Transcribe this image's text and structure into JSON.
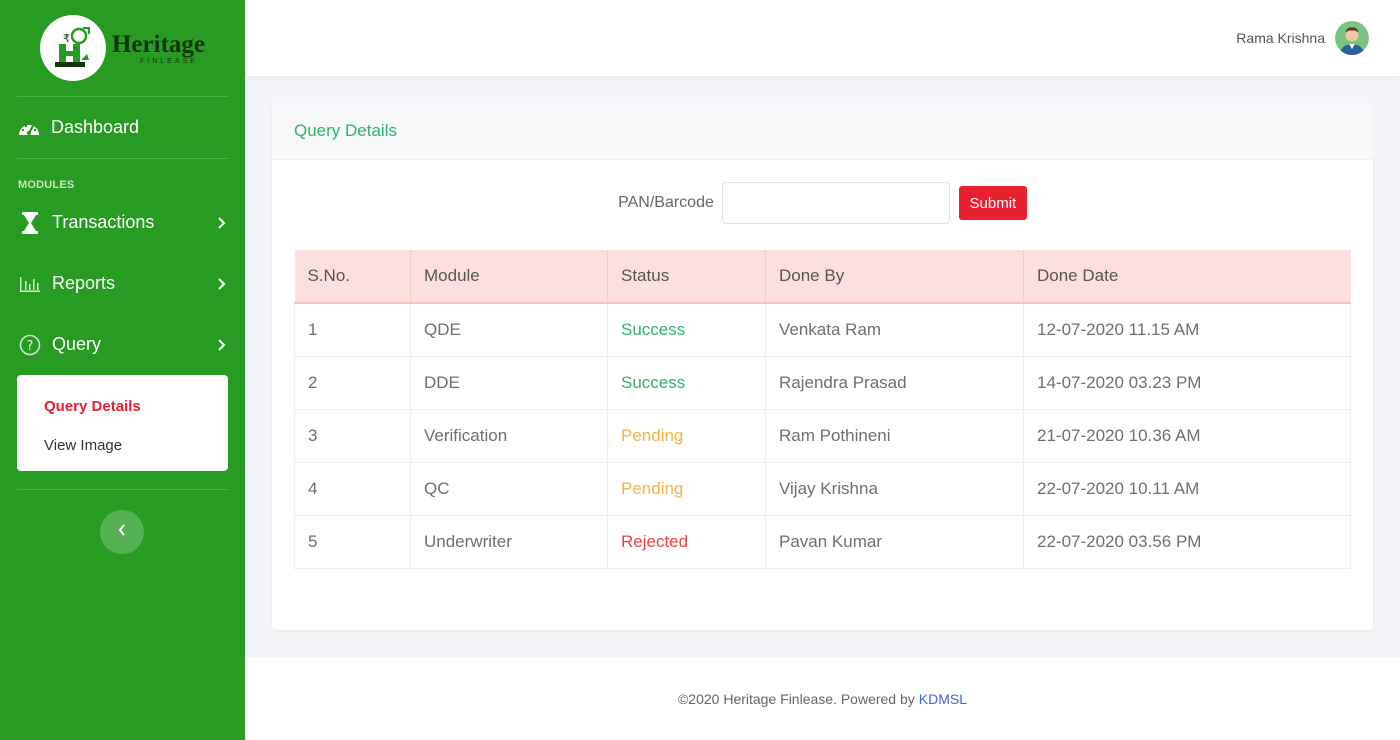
{
  "brand": {
    "name": "Heritage",
    "sub": "FINLEASE"
  },
  "sidebar": {
    "dashboard_label": "Dashboard",
    "modules_label": "MODULES",
    "items": [
      {
        "label": "Transactions",
        "icon": "hourglass-icon"
      },
      {
        "label": "Reports",
        "icon": "bar-chart-icon"
      },
      {
        "label": "Query",
        "icon": "question-circle-icon"
      }
    ],
    "submenu": [
      {
        "label": "Query Details",
        "active": true
      },
      {
        "label": "View Image",
        "active": false
      }
    ]
  },
  "header": {
    "user_name": "Rama Krishna"
  },
  "card": {
    "title": "Query Details",
    "search_label": "PAN/Barcode",
    "search_value": "",
    "submit_label": "Submit"
  },
  "table": {
    "columns": [
      "S.No.",
      "Module",
      "Status",
      "Done By",
      "Done Date"
    ],
    "rows": [
      {
        "sno": "1",
        "module": "QDE",
        "status": "Success",
        "done_by": "Venkata Ram",
        "done_date": "12-07-2020 11.15 AM"
      },
      {
        "sno": "2",
        "module": "DDE",
        "status": "Success",
        "done_by": "Rajendra Prasad",
        "done_date": "14-07-2020 03.23 PM"
      },
      {
        "sno": "3",
        "module": "Verification",
        "status": "Pending",
        "done_by": "Ram Pothineni",
        "done_date": "21-07-2020 10.36 AM"
      },
      {
        "sno": "4",
        "module": "QC",
        "status": "Pending",
        "done_by": "Vijay Krishna",
        "done_date": "22-07-2020 10.11 AM"
      },
      {
        "sno": "5",
        "module": "Underwriter",
        "status": "Rejected",
        "done_by": "Pavan Kumar",
        "done_date": "22-07-2020 03.56 PM"
      }
    ]
  },
  "footer": {
    "text": "©2020 Heritage Finlease. Powered by",
    "link": "KDMSL"
  },
  "colors": {
    "sidebar_bg": "#279b22",
    "accent_red": "#e8202f",
    "success": "#2fb36b",
    "pending": "#f3b33d",
    "rejected": "#e8453c",
    "table_header_bg": "#fde0de"
  }
}
